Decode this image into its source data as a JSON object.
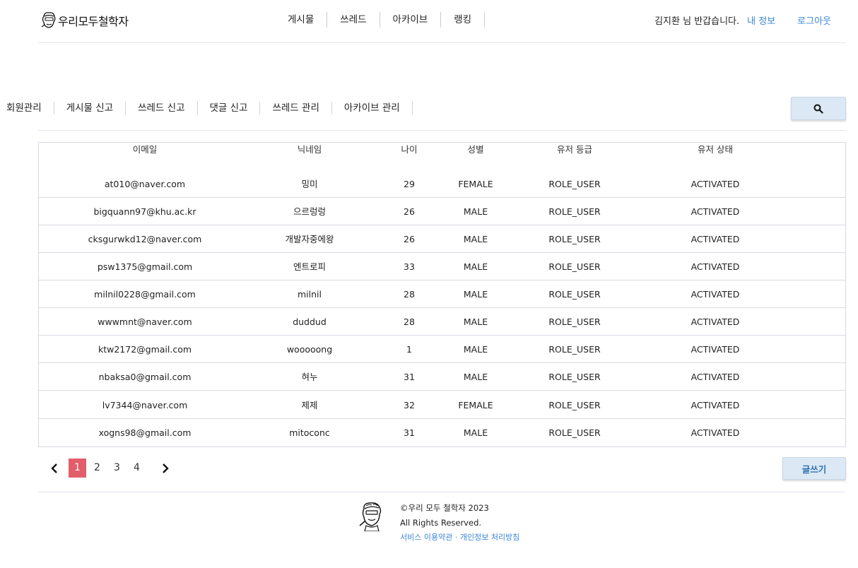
{
  "header": {
    "logo_text": "우리모두철학자",
    "nav": [
      "게시물",
      "쓰레드",
      "아카이브",
      "랭킹"
    ],
    "greeting": "김지환 님 반갑습니다.",
    "mypage_label": "내 정보",
    "logout_label": "로그아웃"
  },
  "admin_nav": [
    "회원관리",
    "게시물 신고",
    "쓰레드 신고",
    "댓글 신고",
    "쓰레드 관리",
    "아카이브 관리"
  ],
  "table": {
    "headers": {
      "email": "이메일",
      "nickname": "닉네임",
      "age": "나이",
      "gender": "성별",
      "role": "유저 등급",
      "status": "유저 상태"
    },
    "rows": [
      {
        "email": "at010@naver.com",
        "nickname": "밍미",
        "age": "29",
        "gender": "FEMALE",
        "role": "ROLE_USER",
        "status": "ACTIVATED"
      },
      {
        "email": "bigquann97@khu.ac.kr",
        "nickname": "으르렁렁",
        "age": "26",
        "gender": "MALE",
        "role": "ROLE_USER",
        "status": "ACTIVATED"
      },
      {
        "email": "cksgurwkd12@naver.com",
        "nickname": "개발자중에왕",
        "age": "26",
        "gender": "MALE",
        "role": "ROLE_USER",
        "status": "ACTIVATED"
      },
      {
        "email": "psw1375@gmail.com",
        "nickname": "엔트로피",
        "age": "33",
        "gender": "MALE",
        "role": "ROLE_USER",
        "status": "ACTIVATED"
      },
      {
        "email": "milnil0228@gmail.com",
        "nickname": "milnil",
        "age": "28",
        "gender": "MALE",
        "role": "ROLE_USER",
        "status": "ACTIVATED"
      },
      {
        "email": "wwwmnt@naver.com",
        "nickname": "duddud",
        "age": "28",
        "gender": "MALE",
        "role": "ROLE_USER",
        "status": "ACTIVATED"
      },
      {
        "email": "ktw2172@gmail.com",
        "nickname": "wooooong",
        "age": "1",
        "gender": "MALE",
        "role": "ROLE_USER",
        "status": "ACTIVATED"
      },
      {
        "email": "nbaksa0@gmail.com",
        "nickname": "혀누",
        "age": "31",
        "gender": "MALE",
        "role": "ROLE_USER",
        "status": "ACTIVATED"
      },
      {
        "email": "lv7344@naver.com",
        "nickname": "제제",
        "age": "32",
        "gender": "FEMALE",
        "role": "ROLE_USER",
        "status": "ACTIVATED"
      },
      {
        "email": "xogns98@gmail.com",
        "nickname": "mitoconc",
        "age": "31",
        "gender": "MALE",
        "role": "ROLE_USER",
        "status": "ACTIVATED"
      }
    ]
  },
  "pagination": {
    "pages": [
      "1",
      "2",
      "3",
      "4"
    ],
    "current": "1"
  },
  "write_button": "글쓰기",
  "footer": {
    "copyright": "©우리 모두 철학자 2023",
    "rights": "All Rights Reserved.",
    "terms_link": "서비스 이용약관",
    "separator": " · ",
    "privacy_link": "개인정보 처리방침"
  },
  "colors": {
    "accent_link": "#3b86d6",
    "active_page": "#e35d6a",
    "button_bg": "#dce8f4"
  }
}
